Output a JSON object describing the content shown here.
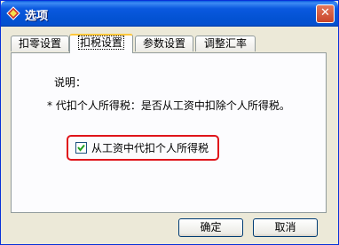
{
  "window": {
    "title": "选项",
    "close_glyph": "✕"
  },
  "tabs": [
    {
      "label": "扣零设置"
    },
    {
      "label": "扣税设置"
    },
    {
      "label": "参数设置"
    },
    {
      "label": "调整汇率"
    }
  ],
  "panel": {
    "note_title": "说明：",
    "note_line": "* 代扣个人所得税：是否从工资中扣除个人所得税。",
    "checkbox_label": "从工资中代扣个人所得税",
    "checkbox_checked": true
  },
  "buttons": {
    "ok": "确定",
    "cancel": "取消"
  }
}
